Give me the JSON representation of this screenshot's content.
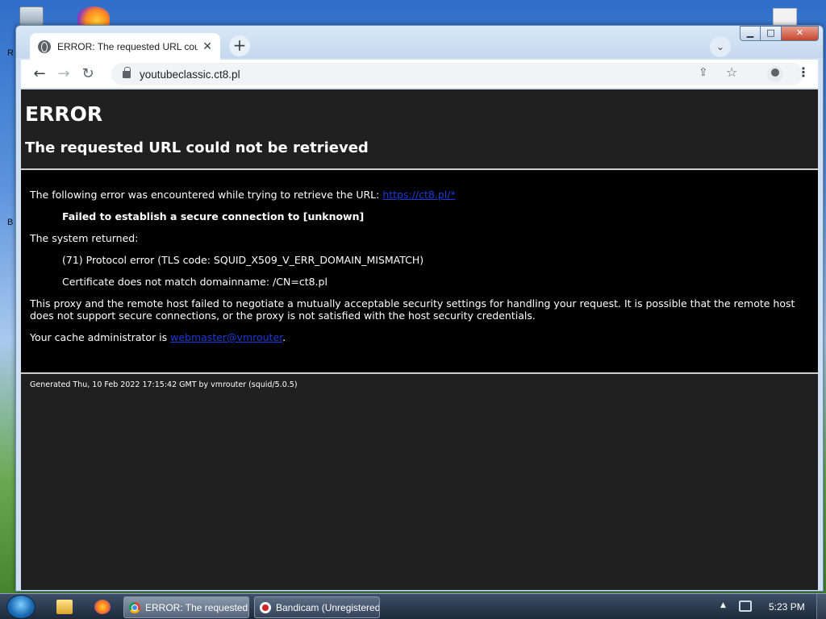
{
  "browser": {
    "tab_title": "ERROR: The requested URL could not be retrieved",
    "tab_close": "✕",
    "new_tab": "+",
    "tab_search": "⌄",
    "url": "youtubeclassic.ct8.pl",
    "window_controls": {
      "minimize": "▁",
      "maximize": "□",
      "close": "✕"
    },
    "nav": {
      "back": "←",
      "forward": "→",
      "reload": "↻"
    },
    "toolbar_icons": {
      "share": "⇪",
      "star": "☆",
      "menu": "⋮"
    }
  },
  "page": {
    "h1": "ERROR",
    "h2": "The requested URL could not be retrieved",
    "p1": "The following error was encountered while trying to retrieve the URL: ",
    "p1_link": "https://ct8.pl/*",
    "p2": "Failed to establish a secure connection to [unknown]",
    "p3": "The system returned:",
    "p4": "(71) Protocol error (TLS code: SQUID_X509_V_ERR_DOMAIN_MISMATCH)",
    "p5": "Certificate does not match domainname: /CN=ct8.pl",
    "p6": "This proxy and the remote host failed to negotiate a mutually acceptable security settings for handling your request. It is possible that the remote host does not support secure connections, or the proxy is not satisfied with the host security credentials.",
    "p7": "Your cache administrator is ",
    "p7_link": "webmaster@vmrouter",
    "p7_end": ".",
    "footer": "Generated Thu, 10 Feb 2022 17:15:42 GMT by vmrouter (squid/5.0.5)",
    "colors": {
      "page_bg": "#202020",
      "content_bg": "#000000",
      "link": "#1a3bd6"
    }
  },
  "desktop": {
    "icon_letters": [
      "R",
      "B"
    ]
  },
  "taskbar": {
    "tasks": [
      {
        "label": "ERROR: The requested URL could not be retrieved"
      },
      {
        "label": "Bandicam (Unregistered)"
      }
    ],
    "tray_arrow": "▲",
    "clock": "5:23 PM"
  }
}
